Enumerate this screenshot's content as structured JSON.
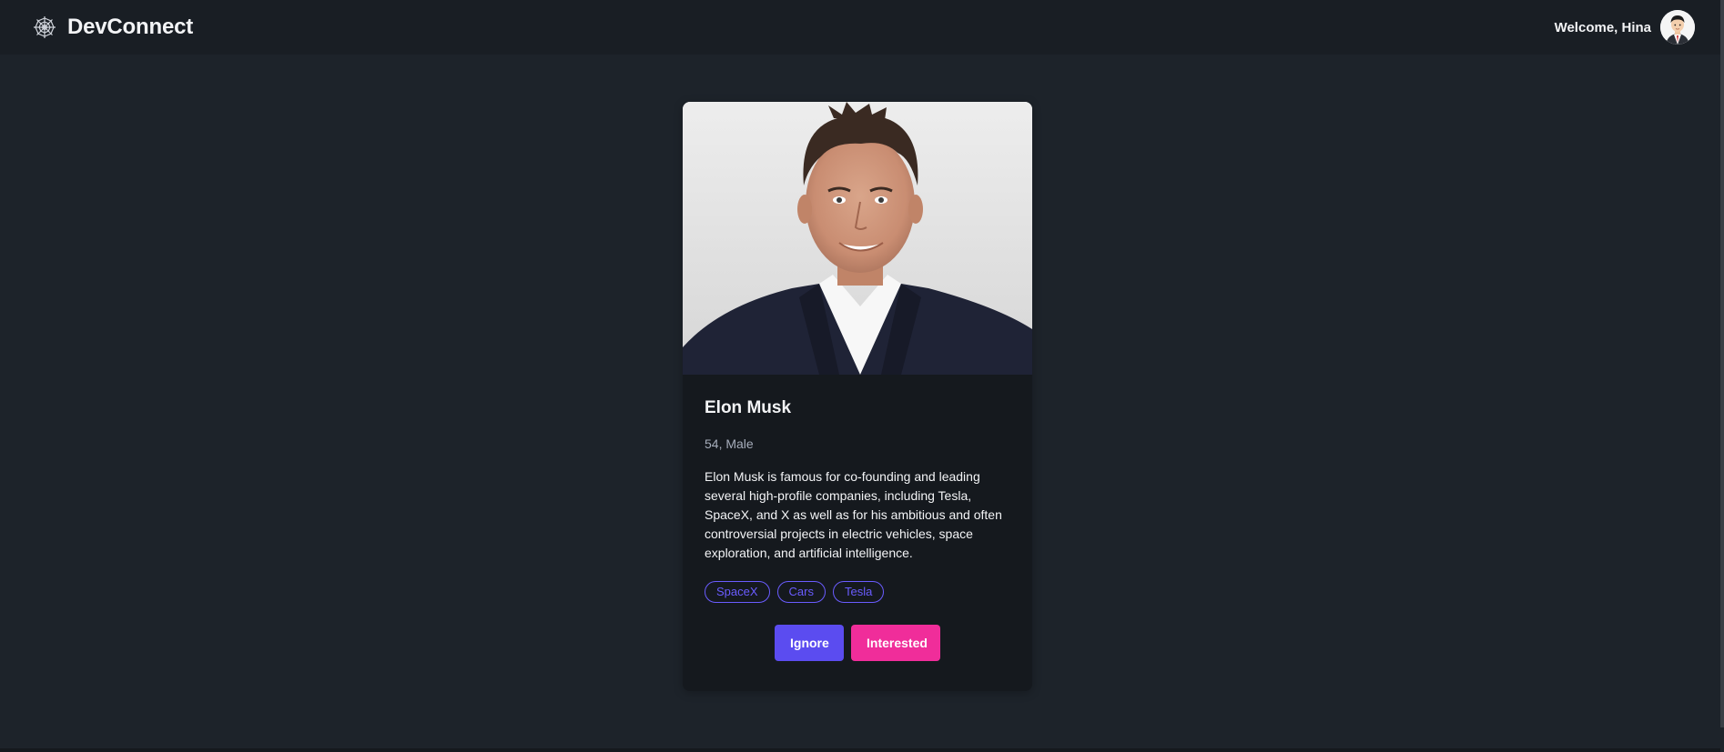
{
  "navbar": {
    "brand": "DevConnect",
    "brand_icon": "spiderweb-icon",
    "welcome": "Welcome, Hina",
    "avatar_icon": "user-avatar"
  },
  "profile": {
    "name": "Elon Musk",
    "meta": "54, Male",
    "about": "Elon Musk is famous for co-founding and leading several high-profile companies, including Tesla, SpaceX, and X as well as for his ambitious and often controversial projects in electric vehicles, space exploration, and artificial intelligence.",
    "skills": [
      "SpaceX",
      "Cars",
      "Tesla"
    ],
    "photo_icon": "profile-photo"
  },
  "actions": {
    "ignore": "Ignore",
    "interested": "Interested"
  },
  "colors": {
    "background": "#1d232a",
    "navbar": "#191e24",
    "card": "#15191e",
    "primary": "#5b4cf0",
    "secondary": "#f02d9a",
    "skill": "#6a5cff"
  }
}
